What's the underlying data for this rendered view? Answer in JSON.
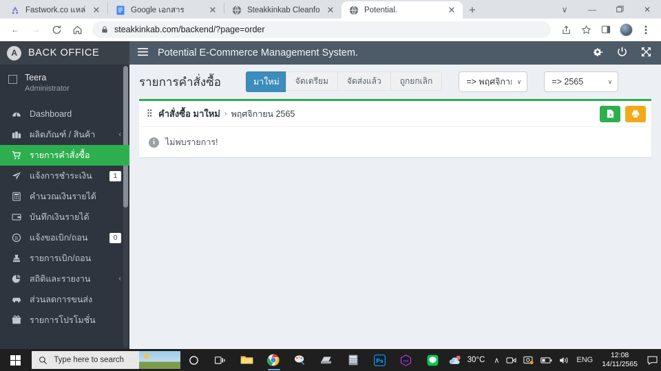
{
  "browser": {
    "tabs": [
      {
        "title": "Fastwork.co แหล่งรวมฟรีแลนซ์คุณภ",
        "icon": "fastwork-favicon",
        "active": false
      },
      {
        "title": "Google เอกสาร",
        "icon": "google-docs-favicon",
        "active": false
      },
      {
        "title": "Steakkinkab Cleanfood.",
        "icon": "globe-favicon",
        "active": false
      },
      {
        "title": "Potential.",
        "icon": "globe-favicon",
        "active": true
      }
    ],
    "new_tab_label": "+",
    "window_controls": {
      "minimize": "—",
      "maximize": "❐",
      "close": "✕",
      "expand": "∨"
    },
    "nav": {
      "back": "←",
      "forward": "→",
      "reload": "⟳",
      "home": "⌂"
    },
    "address": "steakkinkab.com/backend/?page=order",
    "address_lock": "lock-icon",
    "toolbar_icons": [
      "share-icon",
      "bookmark-star-icon",
      "side-panel-icon",
      "profile-avatar",
      "chrome-menu-icon"
    ]
  },
  "sidebar": {
    "brand": {
      "logo_glyph": "A",
      "title": "BACK  OFFICE"
    },
    "user": {
      "name": "Teera",
      "role": "Administrator"
    },
    "items": [
      {
        "label": "Dashboard",
        "icon": "dashboard-icon",
        "badge": "",
        "chevron": "",
        "active": false
      },
      {
        "label": "ผลิตภัณฑ์ / สินค้า",
        "icon": "products-icon",
        "badge": "",
        "chevron": "‹",
        "active": false
      },
      {
        "label": "รายการคำสั่งซื้อ",
        "icon": "cart-icon",
        "badge": "",
        "chevron": "",
        "active": true
      },
      {
        "label": "แจ้งการชำระเงิน",
        "icon": "paper-plane-icon",
        "badge": "1",
        "chevron": "",
        "active": false
      },
      {
        "label": "คำนวณเงินรายได้",
        "icon": "calculator-icon",
        "badge": "",
        "chevron": "",
        "active": false
      },
      {
        "label": "บันทึกเงินรายได้",
        "icon": "wallet-icon",
        "badge": "",
        "chevron": "",
        "active": false
      },
      {
        "label": "แจ้งขอเบิก/ถอน",
        "icon": "baht-circle-icon",
        "badge": "0",
        "chevron": "",
        "active": false
      },
      {
        "label": "รายการเบิก/ถอน",
        "icon": "stamp-icon",
        "badge": "",
        "chevron": "",
        "active": false
      },
      {
        "label": "สถิติและรายงาน",
        "icon": "pie-chart-icon",
        "badge": "",
        "chevron": "‹",
        "active": false
      },
      {
        "label": "ส่วนลดการขนส่ง",
        "icon": "truck-icon",
        "badge": "",
        "chevron": "",
        "active": false
      },
      {
        "label": "รายการโปรโมชั่น",
        "icon": "gift-icon",
        "badge": "",
        "chevron": "",
        "active": false
      }
    ]
  },
  "header": {
    "menu_toggle": "hamburger-icon",
    "title": "Potential E-Commerce Management System.",
    "icons": [
      "gear-icon",
      "power-icon",
      "fullscreen-icon"
    ]
  },
  "page": {
    "title": "รายการคำสั่งซื้อ",
    "filter_tabs": [
      {
        "label": "มาใหม่",
        "selected": true
      },
      {
        "label": "จัดเตรียม",
        "selected": false
      },
      {
        "label": "จัดส่งแล้ว",
        "selected": false
      },
      {
        "label": "ถูกยกเลิก",
        "selected": false
      }
    ],
    "month_select": {
      "value": "=> พฤศจิกาย",
      "caret": "∨"
    },
    "year_select": {
      "value": "=> 2565",
      "caret": "∨"
    }
  },
  "panel": {
    "grip_icon": "drag-grip-icon",
    "breadcrumb_main": "คำสั่งซื้อ มาใหม่",
    "breadcrumb_sep": "›",
    "breadcrumb_sub": "พฤศจิกายน 2565",
    "actions": [
      {
        "name": "export-excel-button",
        "icon": "excel-file-icon",
        "color": "#2eaf4f"
      },
      {
        "name": "print-button",
        "icon": "printer-icon",
        "color": "#f3a81b"
      }
    ],
    "empty_icon": "info-icon",
    "empty_message": "ไม่พบรายการ!"
  },
  "taskbar": {
    "start_icon": "windows-start-icon",
    "search_placeholder": "Type here to search",
    "search_icon": "search-icon",
    "pinned": [
      "cortana-icon",
      "task-view-icon",
      "file-explorer-icon",
      "chrome-icon",
      "paint-icon",
      "scanner-icon",
      "calculator-icon",
      "photoshop-icon",
      "roxio-icon",
      "line-icon"
    ],
    "weather": {
      "icon": "weather-cloud-icon",
      "temperature": "30°C"
    },
    "tray": {
      "overflow_caret": "∧",
      "icons": [
        "webcam-icon",
        "screen-capture-icon",
        "battery-icon",
        "volume-icon"
      ],
      "language": "ENG"
    },
    "clock": {
      "time": "12:08",
      "date": "14/11/2565"
    },
    "notification_icon": "notification-icon"
  },
  "colors": {
    "sidebar_bg": "#2f353f",
    "active_green": "#2eaf4f",
    "header_bg": "#4d5a67",
    "tab_blue": "#3c8dbc",
    "print_orange": "#f3a81b",
    "content_bg": "#ecf0f5"
  }
}
